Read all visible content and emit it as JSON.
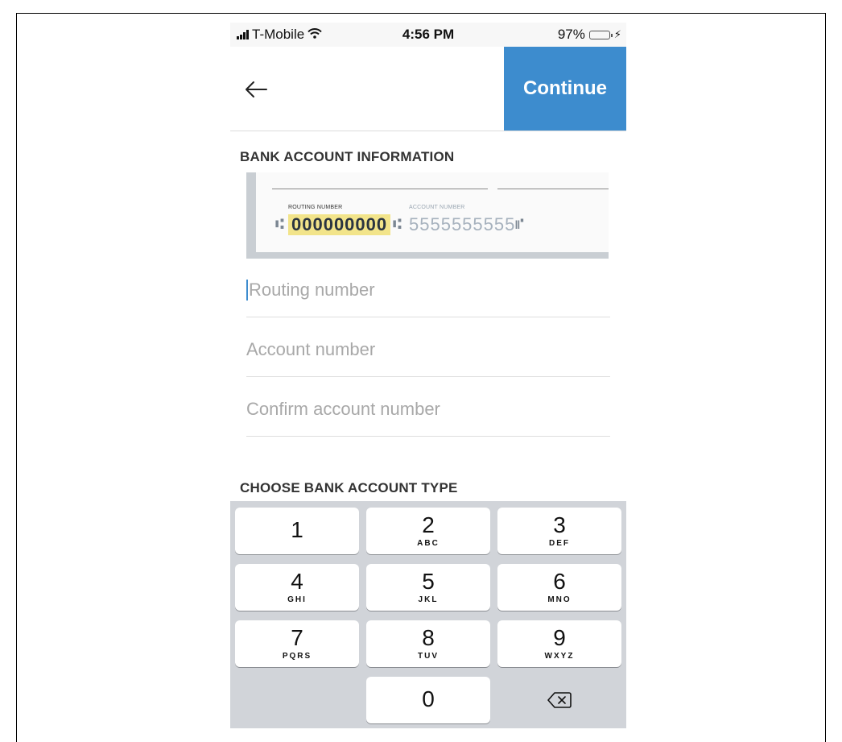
{
  "status_bar": {
    "carrier": "T-Mobile",
    "time": "4:56 PM",
    "battery": "97%",
    "battery_level": 0.97
  },
  "header": {
    "continue_label": "Continue"
  },
  "bank_info": {
    "section_title": "BANK ACCOUNT INFORMATION",
    "check_routing_label": "ROUTING NUMBER",
    "check_routing_value": "000000000",
    "check_account_label": "ACCOUNT NUMBER",
    "check_account_value": "5555555555",
    "routing_placeholder": "Routing number",
    "account_placeholder": "Account number",
    "confirm_placeholder": "Confirm account number"
  },
  "account_type": {
    "section_title": "CHOOSE BANK ACCOUNT TYPE"
  },
  "keypad": {
    "keys": [
      {
        "num": "1",
        "letters": ""
      },
      {
        "num": "2",
        "letters": "ABC"
      },
      {
        "num": "3",
        "letters": "DEF"
      },
      {
        "num": "4",
        "letters": "GHI"
      },
      {
        "num": "5",
        "letters": "JKL"
      },
      {
        "num": "6",
        "letters": "MNO"
      },
      {
        "num": "7",
        "letters": "PQRS"
      },
      {
        "num": "8",
        "letters": "TUV"
      },
      {
        "num": "9",
        "letters": "WXYZ"
      },
      {
        "num": "0",
        "letters": ""
      }
    ]
  },
  "colors": {
    "accent": "#3d8cce",
    "highlight": "#f2e48a",
    "keypad_bg": "#d1d4d9"
  },
  "icons": {
    "back": "arrow-left-icon",
    "delete": "backspace-icon",
    "wifi": "wifi-icon",
    "signal": "signal-icon",
    "battery": "battery-icon"
  }
}
